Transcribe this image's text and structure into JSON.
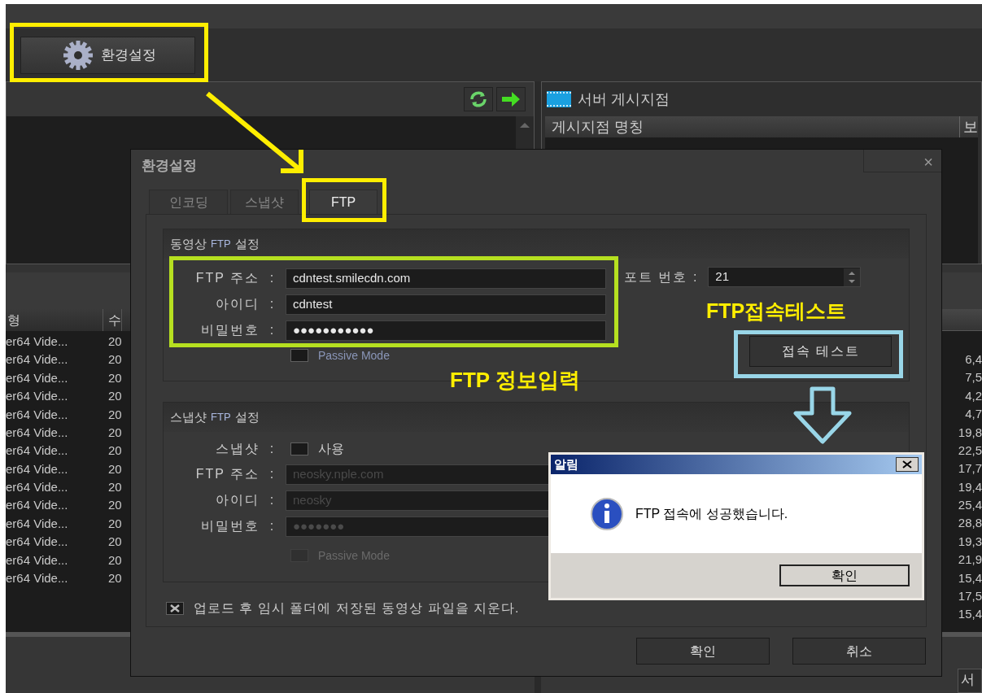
{
  "toolbar": {
    "settings_button": "환경설정"
  },
  "left_panel": {
    "columns": [
      "형",
      "수"
    ],
    "rows": [
      [
        "er64 Vide...",
        "20"
      ],
      [
        "er64 Vide...",
        "20"
      ],
      [
        "er64 Vide...",
        "20"
      ],
      [
        "er64 Vide...",
        "20"
      ],
      [
        "er64 Vide...",
        "20"
      ],
      [
        "er64 Vide...",
        "20"
      ],
      [
        "er64 Vide...",
        "20"
      ],
      [
        "er64 Vide...",
        "20"
      ],
      [
        "er64 Vide...",
        "20"
      ],
      [
        "er64 Vide...",
        "20"
      ],
      [
        "er64 Vide...",
        "20"
      ],
      [
        "er64 Vide...",
        "20"
      ],
      [
        "er64 Vide...",
        "20"
      ],
      [
        "er64 Vide...",
        "20"
      ]
    ]
  },
  "right_panel": {
    "title": "서버 게시지점",
    "columns": [
      "게시지점 명칭",
      "보"
    ],
    "values": [
      "6,4",
      "7,5",
      "4,2",
      "4,7",
      "19,8",
      "22,5",
      "17,7",
      "19,4",
      "25,4",
      "28,8",
      "19,3",
      "21,9",
      "15,4",
      "17,5",
      "15,4"
    ],
    "bottom_tab": "서"
  },
  "dialog": {
    "title": "환경설정",
    "close": "×",
    "tabs": [
      {
        "label": "인코딩",
        "selected": false
      },
      {
        "label": "스냅샷",
        "selected": false
      },
      {
        "label": "FTP",
        "selected": true
      }
    ],
    "video_group": {
      "title_prefix": "동영상",
      "title_ftp": "FTP",
      "title_suffix": "설정",
      "fields": [
        {
          "label": "FTP 주소",
          "colon": ":",
          "value": "cdntest.smilecdn.com"
        },
        {
          "label": "아이디",
          "colon": ":",
          "value": "cdntest"
        },
        {
          "label": "비밀번호",
          "colon": ":",
          "value": "●●●●●●●●●●●"
        }
      ],
      "passive": {
        "label": "Passive Mode",
        "checked": false,
        "disabled": false
      },
      "port_label": "포트 번호 :",
      "port": "21",
      "test_button": "접속 테스트"
    },
    "snapshot_group": {
      "title_prefix": "스냅샷",
      "title_ftp": "FTP",
      "title_suffix": "설정",
      "use": {
        "label": "스냅샷",
        "colon": ":",
        "text": "사용",
        "checked": false
      },
      "fields": [
        {
          "label": "FTP 주소",
          "colon": ":",
          "value": "neosky.nple.com",
          "disabled": true
        },
        {
          "label": "아이디",
          "colon": ":",
          "value": "neosky",
          "disabled": true
        },
        {
          "label": "비밀번호",
          "colon": ":",
          "value": "●●●●●●●",
          "disabled": true
        }
      ],
      "passive": {
        "label": "Passive Mode",
        "checked": false,
        "disabled": true
      }
    },
    "delete_option": {
      "label": "업로드 후 임시 폴더에 저장된 동영상 파일을 지운다.",
      "checked": true
    },
    "buttons": [
      "확인",
      "취소"
    ]
  },
  "alert": {
    "title": "알림",
    "message": "FTP 접속에 성공했습니다.",
    "button": "확인"
  },
  "annotations": [
    {
      "text": "FTP 정보입력"
    },
    {
      "text": "FTP접속테스트"
    }
  ]
}
